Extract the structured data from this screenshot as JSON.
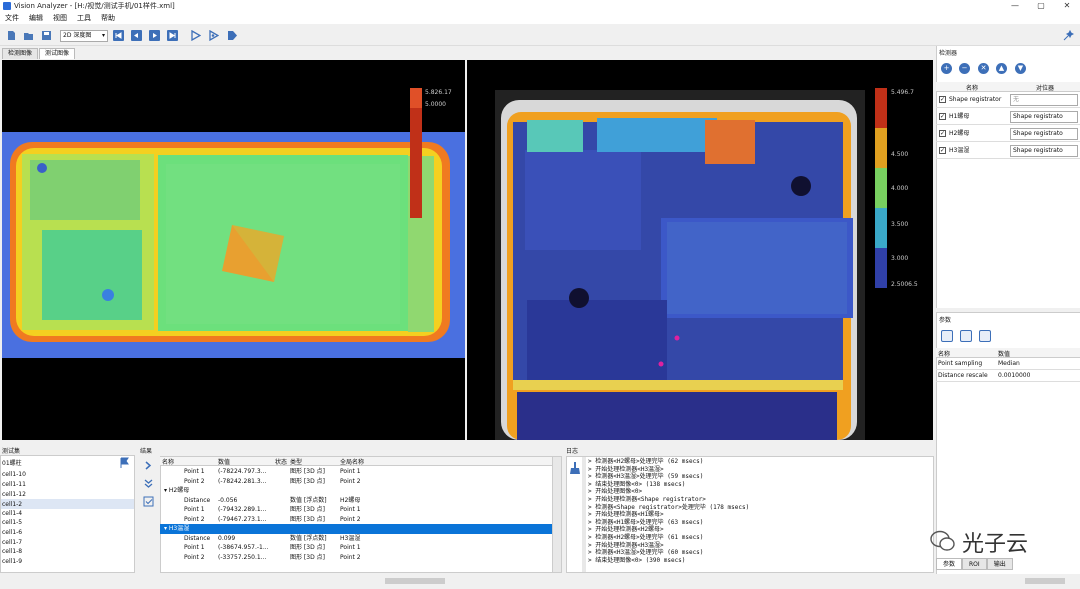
{
  "window": {
    "title": "Vision Analyzer - [H:/视觉/测试手机/01样件.xml]",
    "controls": [
      "—",
      "▢",
      "✕"
    ]
  },
  "menu": [
    "文件",
    "编辑",
    "视图",
    "工具",
    "帮助"
  ],
  "toolbar": {
    "view_select": "2D 深度图",
    "icons": [
      "new-file-icon",
      "open-folder-icon",
      "save-icon",
      "first-icon",
      "prev-icon",
      "next-icon",
      "last-icon",
      "run-icon",
      "run-step-icon",
      "play-icon",
      "settings-wand-icon"
    ]
  },
  "view_tabs": [
    "检测图像",
    "测试图像"
  ],
  "left_view": {
    "scale_max": "5.826.17",
    "scale_second": "5.0000"
  },
  "right_view": {
    "scale_labels": [
      "5.496.7",
      "4.500",
      "4.000",
      "3.500",
      "3.000",
      "2.5006.5"
    ]
  },
  "detectors_panel": {
    "title": "检测器",
    "buttons": [
      "+",
      "−",
      "✕",
      "▲",
      "▼"
    ],
    "col_name": "名称",
    "col_detector": "对位器",
    "rows": [
      {
        "checked": true,
        "name": "Shape registrator",
        "detector": "无"
      },
      {
        "checked": true,
        "name": "H1螺母",
        "detector": "Shape registrato"
      },
      {
        "checked": true,
        "name": "H2螺母",
        "detector": "Shape registrato"
      },
      {
        "checked": true,
        "name": "H3温湿",
        "detector": "Shape registrato"
      }
    ]
  },
  "params_panel": {
    "title": "参数",
    "col_name": "名称",
    "col_value": "数值",
    "rows": [
      {
        "name": "Point sampling",
        "value": "Median"
      },
      {
        "name": "Distance rescale",
        "value": "0.0010000"
      }
    ],
    "tabs": [
      "参数",
      "ROI",
      "输出"
    ]
  },
  "test_set": {
    "title": "测试集",
    "items": [
      "01螺柱",
      "cell1-10",
      "cell1-11",
      "cell1-12",
      "cell1-2",
      "cell1-4",
      "cell1-5",
      "cell1-6",
      "cell1-7",
      "cell1-8",
      "cell1-9"
    ],
    "selected_index": 4
  },
  "results": {
    "title": "结果",
    "headers": [
      "名称",
      "数值",
      "状态",
      "类型",
      "全局名称"
    ],
    "rows": [
      {
        "name": "Point 1",
        "value": "(-78224.797.3...",
        "state": "",
        "type": "图形 [3D 点]",
        "global": "Point 1",
        "indent": 2,
        "selected": false
      },
      {
        "name": "Point 2",
        "value": "(-78242.281.3...",
        "state": "",
        "type": "图形 [3D 点]",
        "global": "Point 2",
        "indent": 2,
        "selected": false
      },
      {
        "name": "▾ H2螺母",
        "value": "",
        "state": "",
        "type": "",
        "global": "",
        "indent": 0,
        "selected": false
      },
      {
        "name": "Distance",
        "value": "-0.056",
        "state": "",
        "type": "数值 [浮点数]",
        "global": "H2螺母",
        "indent": 2,
        "selected": false
      },
      {
        "name": "Point 1",
        "value": "(-79432.289.1...",
        "state": "",
        "type": "图形 [3D 点]",
        "global": "Point 1",
        "indent": 2,
        "selected": false
      },
      {
        "name": "Point 2",
        "value": "(-79467.273.1...",
        "state": "",
        "type": "图形 [3D 点]",
        "global": "Point 2",
        "indent": 2,
        "selected": false
      },
      {
        "name": "▾ H3温湿",
        "value": "",
        "state": "",
        "type": "",
        "global": "",
        "indent": 0,
        "selected": true
      },
      {
        "name": "Distance",
        "value": "0.099",
        "state": "",
        "type": "数值 [浮点数]",
        "global": "H3温湿",
        "indent": 2,
        "selected": false
      },
      {
        "name": "Point 1",
        "value": "(-38674.957.-1...",
        "state": "",
        "type": "图形 [3D 点]",
        "global": "Point 1",
        "indent": 2,
        "selected": false
      },
      {
        "name": "Point 2",
        "value": "(-33757.250.1...",
        "state": "",
        "type": "图形 [3D 点]",
        "global": "Point 2",
        "indent": 2,
        "selected": false
      }
    ]
  },
  "log": {
    "title": "日志",
    "lines": [
      "> 检测器<H2螺母>处理完毕 (62 msecs)",
      "> 开始处理检测器<H3温湿>",
      "> 检测器<H3温湿>处理完毕 (59 msecs)",
      "> 结束处理图像<0> (138 msecs)",
      "> 开始处理图像<0>",
      "> 开始处理检测器<Shape registrator>",
      "> 检测器<Shape registrator>处理完毕 (178 msecs)",
      "> 开始处理检测器<H1螺母>",
      "> 检测器<H1螺母>处理完毕 (63 msecs)",
      "> 开始处理检测器<H2螺母>",
      "> 检测器<H2螺母>处理完毕 (61 msecs)",
      "> 开始处理检测器<H3温湿>",
      "> 检测器<H3温湿>处理完毕 (60 msecs)",
      "> 结束处理图像<0> (390 msecs)"
    ]
  },
  "watermark": "光子云",
  "colors": {
    "selection": "#0a74d8",
    "button_blue": "#3d6fb8",
    "view_bg": "#000000"
  }
}
